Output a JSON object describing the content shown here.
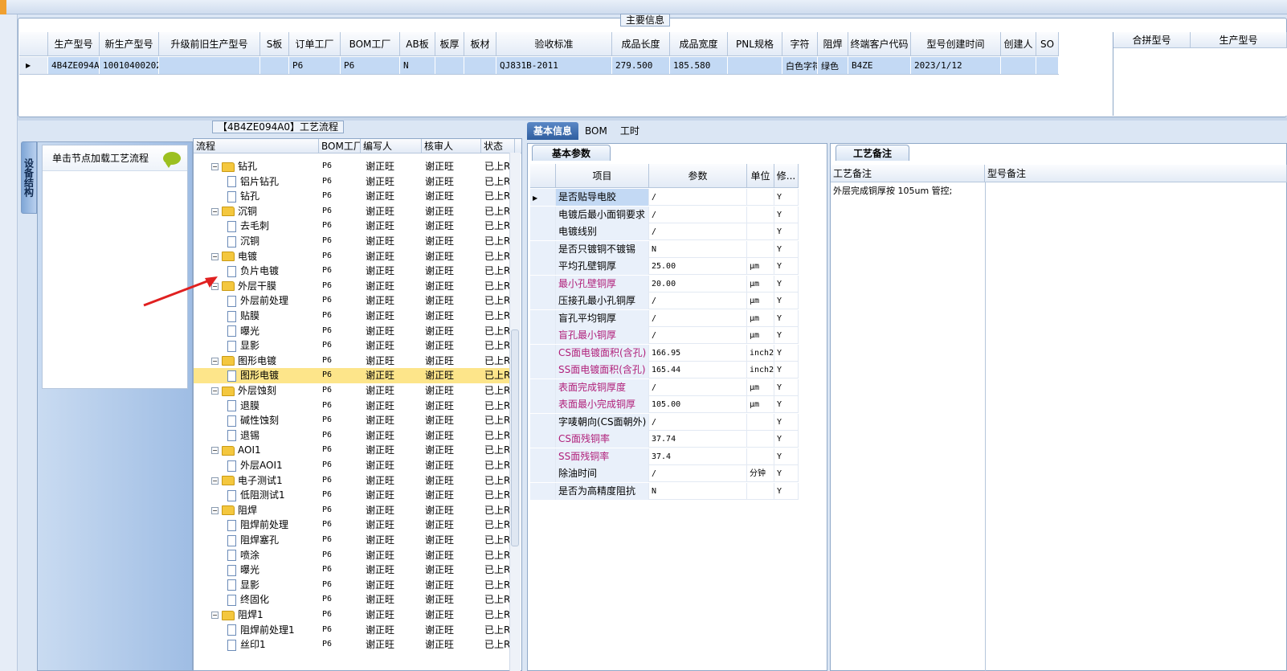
{
  "main_info": {
    "title": "主要信息",
    "columns": [
      "生产型号",
      "新生产型号",
      "升级前旧生产型号",
      "S板",
      "订单工厂",
      "BOM工厂",
      "AB板",
      "板厚",
      "板材",
      "验收标准",
      "成品长度",
      "成品宽度",
      "PNL规格",
      "字符",
      "阻焊",
      "终端客户代码",
      "型号创建时间",
      "创建人",
      "SO"
    ],
    "row": [
      "4B4ZE094A0",
      "10010400202626",
      "",
      "",
      "P6",
      "P6",
      "N",
      "",
      "",
      "QJ831B-2011",
      "279.500",
      "185.580",
      "",
      "白色字符",
      "绿色",
      "B4ZE",
      "2023/1/12",
      "",
      ""
    ],
    "side_columns": [
      "合拼型号",
      "生产型号"
    ]
  },
  "nav": {
    "vertical_tab": "设备结构",
    "hint": "单击节点加载工艺流程"
  },
  "tree": {
    "title": "【4B4ZE094A0】工艺流程",
    "columns": [
      "流程",
      "BOM工厂",
      "编写人",
      "核审人",
      "状态"
    ],
    "rows": [
      {
        "level": 1,
        "name": "钻孔",
        "bom": "P6",
        "writer": "谢正旺",
        "reviewer": "谢正旺",
        "status": "已上R"
      },
      {
        "level": 2,
        "name": "铝片钻孔",
        "bom": "P6",
        "writer": "谢正旺",
        "reviewer": "谢正旺",
        "status": "已上R"
      },
      {
        "level": 2,
        "name": "钻孔",
        "bom": "P6",
        "writer": "谢正旺",
        "reviewer": "谢正旺",
        "status": "已上R"
      },
      {
        "level": 1,
        "name": "沉铜",
        "bom": "P6",
        "writer": "谢正旺",
        "reviewer": "谢正旺",
        "status": "已上R"
      },
      {
        "level": 2,
        "name": "去毛刺",
        "bom": "P6",
        "writer": "谢正旺",
        "reviewer": "谢正旺",
        "status": "已上R"
      },
      {
        "level": 2,
        "name": "沉铜",
        "bom": "P6",
        "writer": "谢正旺",
        "reviewer": "谢正旺",
        "status": "已上R"
      },
      {
        "level": 1,
        "name": "电镀",
        "bom": "P6",
        "writer": "谢正旺",
        "reviewer": "谢正旺",
        "status": "已上R"
      },
      {
        "level": 2,
        "name": "负片电镀",
        "bom": "P6",
        "writer": "谢正旺",
        "reviewer": "谢正旺",
        "status": "已上R"
      },
      {
        "level": 1,
        "name": "外层干膜",
        "bom": "P6",
        "writer": "谢正旺",
        "reviewer": "谢正旺",
        "status": "已上R"
      },
      {
        "level": 2,
        "name": "外层前处理",
        "bom": "P6",
        "writer": "谢正旺",
        "reviewer": "谢正旺",
        "status": "已上R"
      },
      {
        "level": 2,
        "name": "贴膜",
        "bom": "P6",
        "writer": "谢正旺",
        "reviewer": "谢正旺",
        "status": "已上R"
      },
      {
        "level": 2,
        "name": "曝光",
        "bom": "P6",
        "writer": "谢正旺",
        "reviewer": "谢正旺",
        "status": "已上R"
      },
      {
        "level": 2,
        "name": "显影",
        "bom": "P6",
        "writer": "谢正旺",
        "reviewer": "谢正旺",
        "status": "已上R"
      },
      {
        "level": 1,
        "name": "图形电镀",
        "bom": "P6",
        "writer": "谢正旺",
        "reviewer": "谢正旺",
        "status": "已上R"
      },
      {
        "level": 2,
        "name": "图形电镀",
        "bom": "P6",
        "writer": "谢正旺",
        "reviewer": "谢正旺",
        "status": "已上R",
        "selected": true
      },
      {
        "level": 1,
        "name": "外层蚀刻",
        "bom": "P6",
        "writer": "谢正旺",
        "reviewer": "谢正旺",
        "status": "已上R"
      },
      {
        "level": 2,
        "name": "退膜",
        "bom": "P6",
        "writer": "谢正旺",
        "reviewer": "谢正旺",
        "status": "已上R"
      },
      {
        "level": 2,
        "name": "碱性蚀刻",
        "bom": "P6",
        "writer": "谢正旺",
        "reviewer": "谢正旺",
        "status": "已上R"
      },
      {
        "level": 2,
        "name": "退锡",
        "bom": "P6",
        "writer": "谢正旺",
        "reviewer": "谢正旺",
        "status": "已上R"
      },
      {
        "level": 1,
        "name": "AOI1",
        "bom": "P6",
        "writer": "谢正旺",
        "reviewer": "谢正旺",
        "status": "已上R"
      },
      {
        "level": 2,
        "name": "外层AOI1",
        "bom": "P6",
        "writer": "谢正旺",
        "reviewer": "谢正旺",
        "status": "已上R"
      },
      {
        "level": 1,
        "name": "电子测试1",
        "bom": "P6",
        "writer": "谢正旺",
        "reviewer": "谢正旺",
        "status": "已上R"
      },
      {
        "level": 2,
        "name": "低阻测试1",
        "bom": "P6",
        "writer": "谢正旺",
        "reviewer": "谢正旺",
        "status": "已上R"
      },
      {
        "level": 1,
        "name": "阻焊",
        "bom": "P6",
        "writer": "谢正旺",
        "reviewer": "谢正旺",
        "status": "已上R"
      },
      {
        "level": 2,
        "name": "阻焊前处理",
        "bom": "P6",
        "writer": "谢正旺",
        "reviewer": "谢正旺",
        "status": "已上R"
      },
      {
        "level": 2,
        "name": "阻焊塞孔",
        "bom": "P6",
        "writer": "谢正旺",
        "reviewer": "谢正旺",
        "status": "已上R"
      },
      {
        "level": 2,
        "name": "喷涂",
        "bom": "P6",
        "writer": "谢正旺",
        "reviewer": "谢正旺",
        "status": "已上R"
      },
      {
        "level": 2,
        "name": "曝光",
        "bom": "P6",
        "writer": "谢正旺",
        "reviewer": "谢正旺",
        "status": "已上R"
      },
      {
        "level": 2,
        "name": "显影",
        "bom": "P6",
        "writer": "谢正旺",
        "reviewer": "谢正旺",
        "status": "已上R"
      },
      {
        "level": 2,
        "name": "终固化",
        "bom": "P6",
        "writer": "谢正旺",
        "reviewer": "谢正旺",
        "status": "已上R"
      },
      {
        "level": 1,
        "name": "阻焊1",
        "bom": "P6",
        "writer": "谢正旺",
        "reviewer": "谢正旺",
        "status": "已上R"
      },
      {
        "level": 2,
        "name": "阻焊前处理1",
        "bom": "P6",
        "writer": "谢正旺",
        "reviewer": "谢正旺",
        "status": "已上R"
      },
      {
        "level": 2,
        "name": "丝印1",
        "bom": "P6",
        "writer": "谢正旺",
        "reviewer": "谢正旺",
        "status": "已上R"
      }
    ]
  },
  "tabs": [
    "基本信息",
    "BOM",
    "工时"
  ],
  "params": {
    "tab": "基本参数",
    "columns": [
      "项目",
      "参数",
      "单位",
      "修..."
    ],
    "rows": [
      {
        "item": "是否贴导电胶",
        "value": "/",
        "unit": "",
        "mod": "Y",
        "pink": false,
        "current": true
      },
      {
        "item": "电镀后最小面铜要求",
        "value": "/",
        "unit": "",
        "mod": "Y",
        "pink": false
      },
      {
        "item": "电镀线别",
        "value": "/",
        "unit": "",
        "mod": "Y",
        "pink": false
      },
      {
        "item": "是否只镀铜不镀锡",
        "value": "N",
        "unit": "",
        "mod": "Y",
        "pink": false
      },
      {
        "item": "平均孔壁铜厚",
        "value": "25.00",
        "unit": "μm",
        "mod": "Y",
        "pink": false
      },
      {
        "item": "最小孔壁铜厚",
        "value": "20.00",
        "unit": "μm",
        "mod": "Y",
        "pink": true
      },
      {
        "item": "压接孔最小孔铜厚",
        "value": "/",
        "unit": "μm",
        "mod": "Y",
        "pink": false
      },
      {
        "item": "盲孔平均铜厚",
        "value": "/",
        "unit": "μm",
        "mod": "Y",
        "pink": false
      },
      {
        "item": "盲孔最小铜厚",
        "value": "/",
        "unit": "μm",
        "mod": "Y",
        "pink": true
      },
      {
        "item": "CS面电镀面积(含孔)",
        "value": "166.95",
        "unit": "inch2",
        "mod": "Y",
        "pink": true
      },
      {
        "item": "SS面电镀面积(含孔)",
        "value": "165.44",
        "unit": "inch2",
        "mod": "Y",
        "pink": true
      },
      {
        "item": "表面完成铜厚度",
        "value": "/",
        "unit": "μm",
        "mod": "Y",
        "pink": true
      },
      {
        "item": "表面最小完成铜厚",
        "value": "105.00",
        "unit": "μm",
        "mod": "Y",
        "pink": true
      },
      {
        "item": "字唛朝向(CS面朝外)",
        "value": "/",
        "unit": "",
        "mod": "Y",
        "pink": false
      },
      {
        "item": "CS面残铜率",
        "value": "37.74",
        "unit": "",
        "mod": "Y",
        "pink": true
      },
      {
        "item": "SS面残铜率",
        "value": "37.4",
        "unit": "",
        "mod": "Y",
        "pink": true
      },
      {
        "item": "除油时间",
        "value": "/",
        "unit": "分钟",
        "mod": "Y",
        "pink": false
      },
      {
        "item": "是否为高精度阻抗",
        "value": "N",
        "unit": "",
        "mod": "Y",
        "pink": false
      }
    ]
  },
  "remarks": {
    "tab": "工艺备注",
    "columns": [
      "工艺备注",
      "型号备注"
    ],
    "process_note": "外层完成铜厚按 105um 管控;"
  }
}
